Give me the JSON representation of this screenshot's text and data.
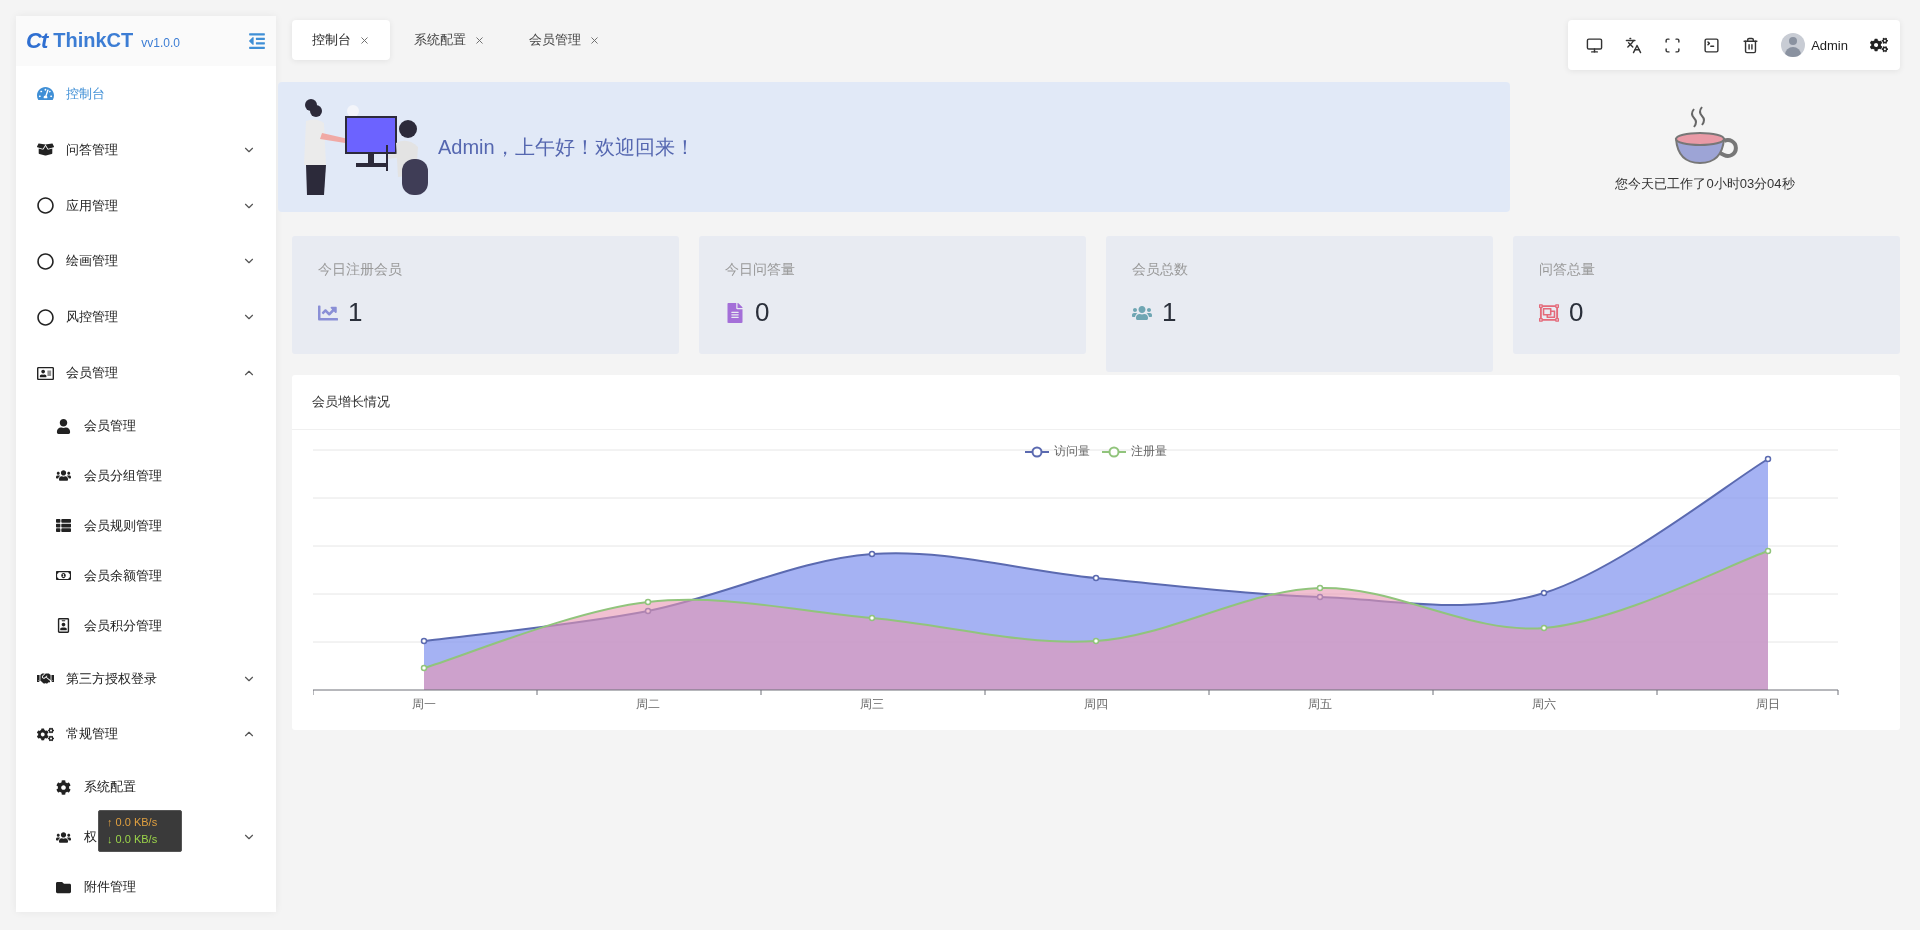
{
  "sidebar": {
    "logo_mark": "Ct",
    "brand": "ThinkCT",
    "version": "vv1.0.0",
    "items": [
      {
        "label": "控制台",
        "selected": true
      },
      {
        "label": "问答管理",
        "selected": false,
        "expanded": false
      },
      {
        "label": "应用管理",
        "selected": false,
        "expanded": false
      },
      {
        "label": "绘画管理",
        "selected": false,
        "expanded": false
      },
      {
        "label": "风控管理",
        "selected": false,
        "expanded": false
      },
      {
        "label": "会员管理",
        "selected": false,
        "expanded": true,
        "children": [
          {
            "label": "会员管理",
            "selected": false
          },
          {
            "label": "会员分组管理",
            "selected": false
          },
          {
            "label": "会员规则管理",
            "selected": false
          },
          {
            "label": "会员余额管理",
            "selected": false
          },
          {
            "label": "会员积分管理",
            "selected": false
          }
        ]
      },
      {
        "label": "第三方授权登录",
        "selected": false,
        "expanded": false
      },
      {
        "label": "常规管理",
        "selected": false,
        "expanded": true,
        "children": [
          {
            "label": "系统配置",
            "selected": false
          },
          {
            "label": "权",
            "selected": false,
            "expanded": false
          },
          {
            "label": "附件管理",
            "selected": false
          }
        ]
      }
    ]
  },
  "tabs": [
    {
      "label": "控制台",
      "selected": true
    },
    {
      "label": "系统配置",
      "selected": false
    },
    {
      "label": "会员管理",
      "selected": false
    }
  ],
  "toolbar": {
    "user": "Admin"
  },
  "banner": {
    "greeting": "Admin，上午好！欢迎回来！"
  },
  "work_time": "您今天已工作了0小时03分04秒",
  "stats": [
    {
      "label": "今日注册会员",
      "value": "1",
      "hovered": false
    },
    {
      "label": "今日问答量",
      "value": "0",
      "hovered": false
    },
    {
      "label": "会员总数",
      "value": "1",
      "hovered": true
    },
    {
      "label": "问答总量",
      "value": "0",
      "hovered": false
    }
  ],
  "chart": {
    "title": "会员增长情况",
    "legend": [
      {
        "name": "访问量",
        "color": "#5b6ab0"
      },
      {
        "name": "注册量",
        "color": "#91c47c"
      }
    ],
    "categories": [
      "周一",
      "周二",
      "周三",
      "周四",
      "周五",
      "周六",
      "周日"
    ]
  },
  "net_speed": {
    "up": "↑ 0.0 KB/s",
    "down": "↓ 0.0 KB/s"
  }
}
